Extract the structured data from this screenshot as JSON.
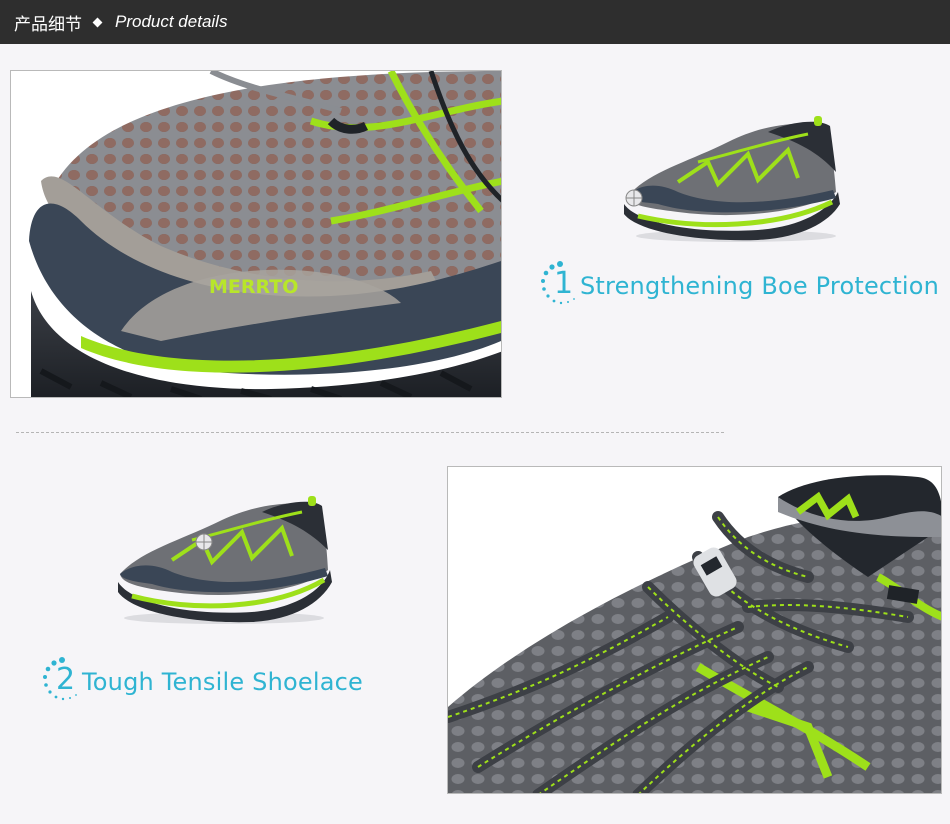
{
  "header": {
    "title_cn": "产品细节",
    "title_en": "Product details"
  },
  "photos": {
    "toe_closeup": {
      "logo_text": "MERRTO"
    },
    "lace_closeup": {}
  },
  "features": [
    {
      "number": "1",
      "label": "Strengthening Boe Protection"
    },
    {
      "number": "2",
      "label": "Tough Tensile Shoelace"
    }
  ],
  "colors": {
    "header_bg": "#2e2e2e",
    "accent_cyan": "#2fb4d2",
    "shoe_green": "#9ee01a",
    "shoe_gray": "#6e7075",
    "shoe_dark": "#2b2f36"
  }
}
